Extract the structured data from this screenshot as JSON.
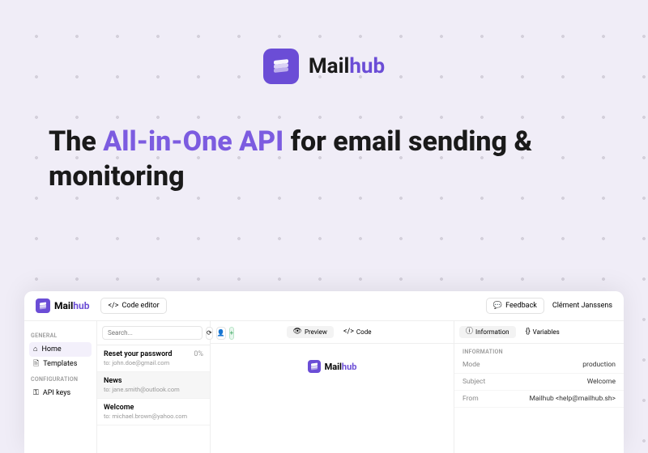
{
  "logo": {
    "mail": "Mail",
    "hub": "hub"
  },
  "headline": {
    "pre": "The ",
    "accent": "All-in-One API",
    "post": " for email sending & monitoring"
  },
  "topbar": {
    "code_editor": "Code editor",
    "feedback": "Feedback",
    "user": "Clément Janssens"
  },
  "sidebar": {
    "general_label": "GENERAL",
    "config_label": "CONFIGURATION",
    "home": "Home",
    "templates": "Templates",
    "api_keys": "API keys"
  },
  "search": {
    "placeholder": "Search..."
  },
  "list": [
    {
      "title": "Reset your password",
      "to": "to: john.doe@gmail.com",
      "pct": "0%"
    },
    {
      "title": "News",
      "to": "to: jane.smith@outlook.com",
      "pct": ""
    },
    {
      "title": "Welcome",
      "to": "to: michael.brown@yahoo.com",
      "pct": ""
    }
  ],
  "preview_tabs": {
    "preview": "Preview",
    "code": "Code"
  },
  "info_tabs": {
    "information": "Information",
    "variables": "Variables"
  },
  "info": {
    "section": "INFORMATION",
    "mode_k": "Mode",
    "mode_v": "production",
    "subject_k": "Subject",
    "subject_v": "Welcome",
    "from_k": "From",
    "from_v": "Mailhub <help@mailhub.sh>"
  },
  "icons": {
    "code": "</>",
    "chat": "💬",
    "home": "⌂",
    "doc": "🖹",
    "key": "⚿",
    "refresh": "⟳",
    "user": "👤",
    "plus": "+",
    "eye": "👁",
    "info": "ⓘ",
    "var": "{}"
  }
}
